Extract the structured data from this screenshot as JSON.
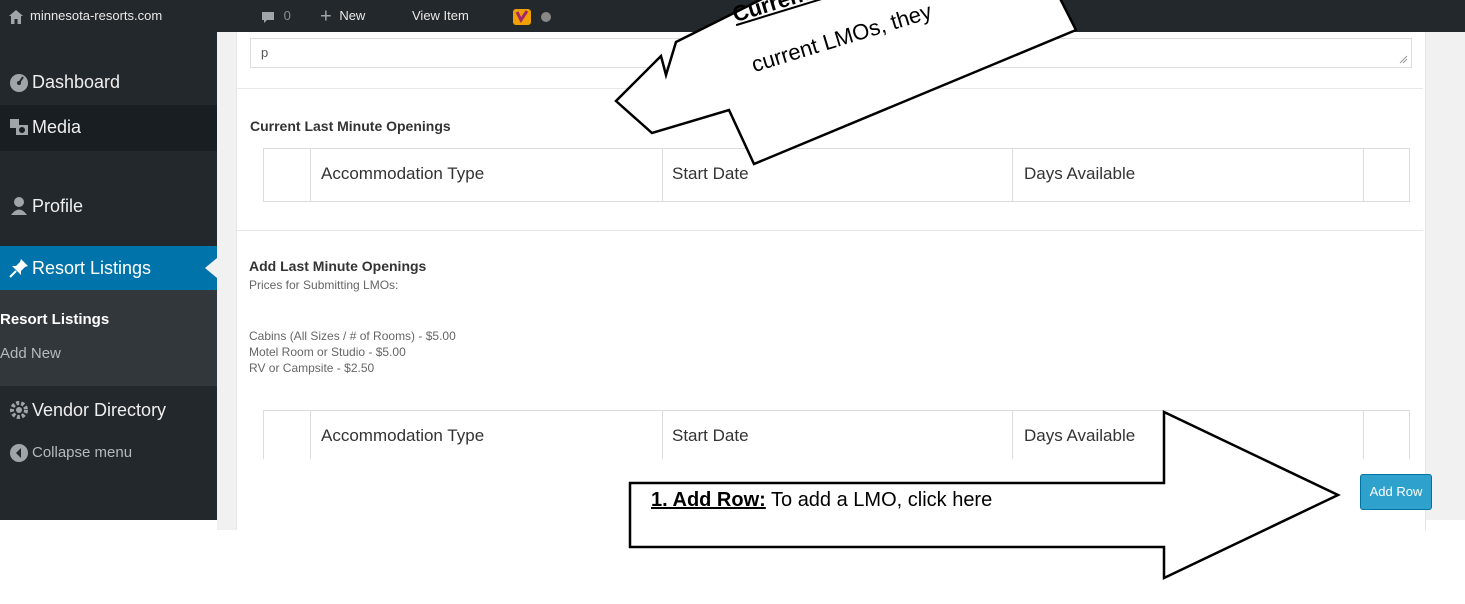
{
  "adminbar": {
    "site_name": "minnesota-resorts.com",
    "comments_count": "0",
    "new_label": "New",
    "view_item_label": "View Item"
  },
  "sidebar": {
    "dashboard": "Dashboard",
    "media": "Media",
    "profile": "Profile",
    "resort_listings": "Resort Listings",
    "submenu": [
      "Resort Listings",
      "Add New"
    ],
    "vendor_directory": "Vendor Directory",
    "collapse": "Collapse menu",
    "active_color": "#0073aa"
  },
  "editor": {
    "textarea_value": "p"
  },
  "current_section": {
    "title": "Current Last Minute Openings",
    "columns": [
      "Accommodation Type",
      "Start Date",
      "Days Available"
    ]
  },
  "add_section": {
    "title": "Add Last Minute Openings",
    "prices_heading": "Prices for Submitting LMOs:",
    "prices": [
      "Cabins (All Sizes / # of Rooms) - $5.00",
      "Motel Room or Studio - $5.00",
      "RV or Campsite - $2.50"
    ],
    "columns": [
      "Accommodation Type",
      "Start Date",
      "Days Available"
    ],
    "add_row_label": "Add Row"
  },
  "callouts": {
    "top_line1": "Current L",
    "top_line2": "current LMOs, they",
    "bottom_bold": "1.  Add Row:",
    "bottom_text": " To add a LMO, click here"
  }
}
